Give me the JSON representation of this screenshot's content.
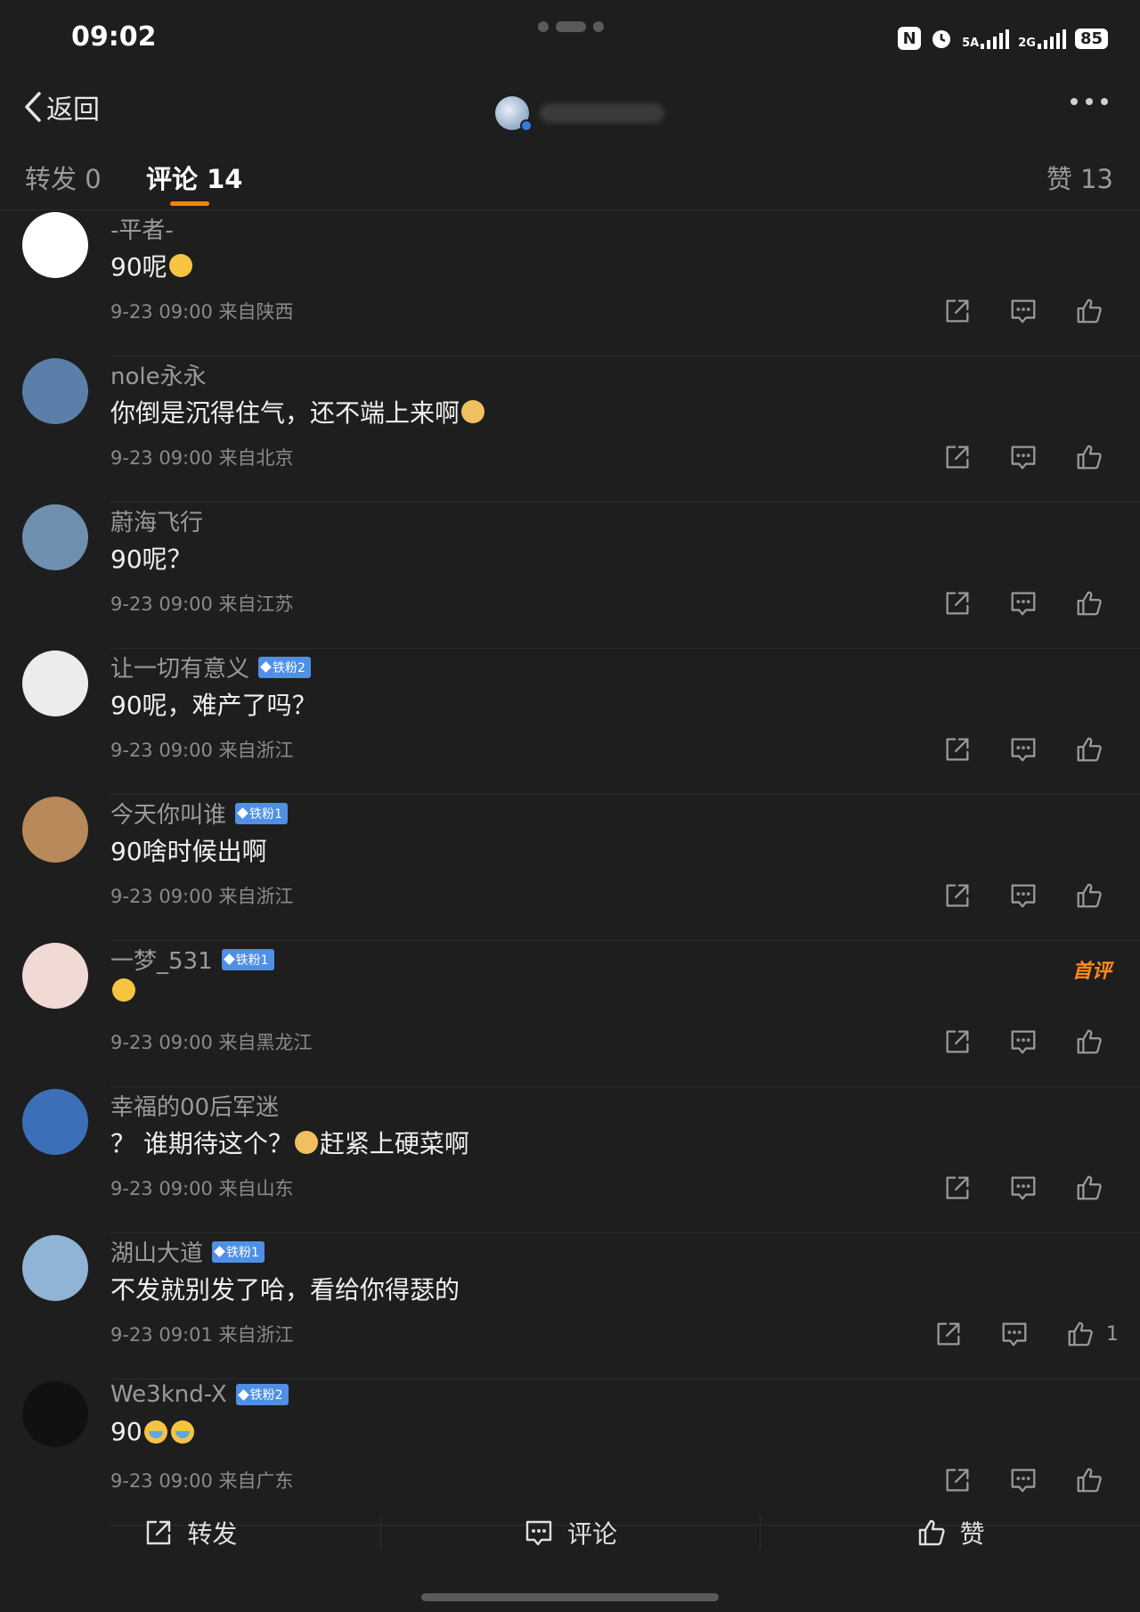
{
  "status_bar": {
    "time": "09:02",
    "network_1": "5A",
    "network_2": "2G",
    "battery": "85"
  },
  "nav": {
    "back_label": "返回"
  },
  "tabs": {
    "repost": "转发 0",
    "comments": "评论 14",
    "likes": "赞 13"
  },
  "comments": [
    {
      "user": "-平者-",
      "badge": "",
      "text": "90呢",
      "emoji": "shush-emoji",
      "meta": "9-23 09:00 来自陕西",
      "likes": "",
      "avatar_color": "#ffffff"
    },
    {
      "user": "nole永永",
      "badge": "",
      "text": "你倒是沉得住气，还不端上来啊",
      "emoji": "doge-emoji",
      "meta": "9-23 09:00 来自北京",
      "likes": "",
      "avatar_color": "#5b7fa8"
    },
    {
      "user": "蔚海飞行",
      "badge": "",
      "text": "90呢？",
      "emoji": "",
      "meta": "9-23 09:00 来自江苏",
      "likes": "",
      "avatar_color": "#6f8fb0"
    },
    {
      "user": "让一切有意义",
      "badge": "铁粉2",
      "text": "90呢，难产了吗？",
      "emoji": "",
      "meta": "9-23 09:00 来自浙江",
      "likes": "",
      "avatar_color": "#ececec"
    },
    {
      "user": "今天你叫谁",
      "badge": "铁粉1",
      "text": "90啥时候出啊",
      "emoji": "",
      "meta": "9-23 09:00 来自浙江",
      "likes": "",
      "avatar_color": "#b8895a"
    },
    {
      "user": "一梦_531",
      "badge": "铁粉1",
      "text": "",
      "emoji": "sweat-emoji",
      "meta": "9-23 09:00 来自黑龙江",
      "likes": "",
      "avatar_color": "#f1d9d4",
      "tag": "首评"
    },
    {
      "user": "幸福的00后军迷",
      "badge": "",
      "text": "？ 谁期待这个？",
      "emoji": "doge-emoji",
      "text_after": "赶紧上硬菜啊",
      "meta": "9-23 09:00 来自山东",
      "likes": "",
      "avatar_color": "#3b6fb8"
    },
    {
      "user": "湖山大道",
      "badge": "铁粉1",
      "text": "不发就别发了哈，看给你得瑟的",
      "emoji": "",
      "meta": "9-23 09:01 来自浙江",
      "likes": "1",
      "avatar_color": "#8fb4d6"
    },
    {
      "user": "We3knd-X",
      "badge": "铁粉2",
      "text": "90",
      "emoji": "cry-emoji",
      "meta": "9-23 09:00 来自广东",
      "likes": "",
      "avatar_color": "#111111"
    }
  ],
  "bottom_bar": {
    "repost": "转发",
    "comment": "评论",
    "like": "赞"
  },
  "colors": {
    "background": "#1e1e1e",
    "accent": "#ff8200",
    "badge": "#4f8fe6"
  }
}
